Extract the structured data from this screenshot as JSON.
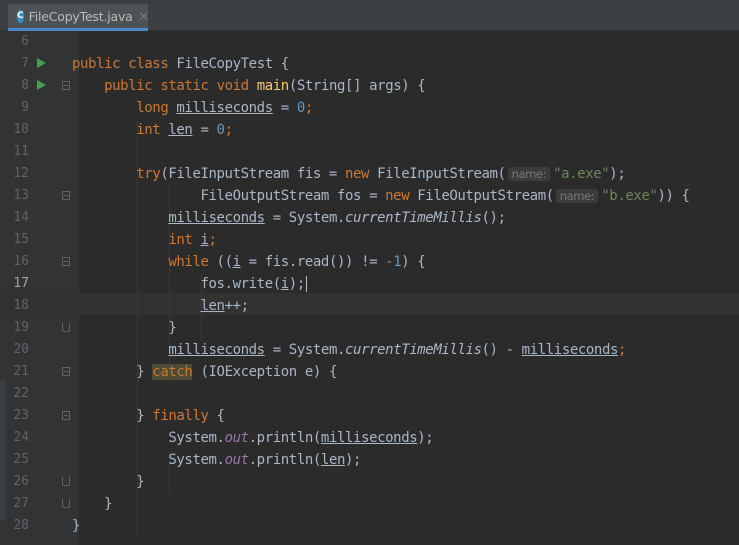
{
  "tab": {
    "filename": "FileCopyTest.java",
    "icon": "java-class-icon",
    "close": "×",
    "icon_letter": "C"
  },
  "colors": {
    "background": "#2b2b2b",
    "gutter": "#313335",
    "keyword": "#cc7832",
    "string": "#6a8759",
    "number": "#6897bb",
    "method": "#ffc66d",
    "field": "#9876aa"
  },
  "editor": {
    "current_line": 17,
    "lines": [
      {
        "n": "6"
      },
      {
        "n": "7"
      },
      {
        "n": "8"
      },
      {
        "n": "9"
      },
      {
        "n": "10"
      },
      {
        "n": "11"
      },
      {
        "n": "12"
      },
      {
        "n": "13"
      },
      {
        "n": "14"
      },
      {
        "n": "15"
      },
      {
        "n": "16"
      },
      {
        "n": "17"
      },
      {
        "n": "18"
      },
      {
        "n": "19"
      },
      {
        "n": "20"
      },
      {
        "n": "21"
      },
      {
        "n": "22"
      },
      {
        "n": "23"
      },
      {
        "n": "24"
      },
      {
        "n": "25"
      },
      {
        "n": "26"
      },
      {
        "n": "27"
      },
      {
        "n": "28"
      }
    ]
  },
  "code": {
    "l7": {
      "public": "public",
      "class": "class",
      "name": "FileCopyTest",
      "brace": " {"
    },
    "l8": {
      "public": "public",
      "static": "static",
      "void": "void",
      "main": "main",
      "params": "(String[] args) {"
    },
    "l9": {
      "type": "long",
      "var": "milliseconds",
      "eq": " = ",
      "val": "0",
      "semi": ";"
    },
    "l10": {
      "type": "int",
      "var": "len",
      "eq": " = ",
      "val": "0",
      "semi": ";"
    },
    "l12": {
      "try": "try",
      "open": "(FileInputStream fis = ",
      "new": "new",
      "ctor": " FileInputStream(",
      "hint": "name:",
      "str": "\"a.exe\"",
      "end": ");"
    },
    "l13": {
      "open": "FileOutputStream fos = ",
      "new": "new",
      "ctor": " FileOutputStream(",
      "hint": "name:",
      "str": "\"b.exe\"",
      "end": ")) {"
    },
    "l14": {
      "var": "milliseconds",
      "mid": " = System.",
      "call": "currentTimeMillis",
      "end": "();"
    },
    "l15": {
      "type": "int",
      "var": "i",
      "semi": ";"
    },
    "l16": {
      "while": "while",
      "a": " ((",
      "var": "i",
      "b": " = fis.read()) != ",
      "num": "-1",
      "c": ") {"
    },
    "l17": {
      "a": "fos.write(",
      "var": "i",
      "b": ");"
    },
    "l18": {
      "var": "len",
      "b": "++;"
    },
    "l19": {
      "text": "}"
    },
    "l20": {
      "var": "milliseconds",
      "mid": " = System.",
      "call": "currentTimeMillis",
      "m2": "() - ",
      "var2": "milliseconds",
      "semi": ";"
    },
    "l21": {
      "a": "} ",
      "catch": "catch",
      "b": " (IOException e) {"
    },
    "l23": {
      "a": "} ",
      "finally": "finally",
      "b": " {"
    },
    "l24": {
      "a": "System.",
      "out": "out",
      "b": ".println(",
      "var": "milliseconds",
      "c": ");"
    },
    "l25": {
      "a": "System.",
      "out": "out",
      "b": ".println(",
      "var": "len",
      "c": ");"
    },
    "l26": {
      "text": "}"
    },
    "l27": {
      "text": "}"
    },
    "l28": {
      "text": "}"
    }
  }
}
